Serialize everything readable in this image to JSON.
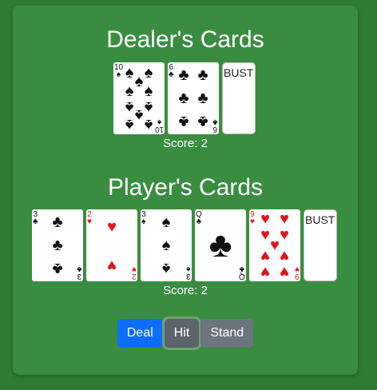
{
  "dealer": {
    "title": "Dealer's Cards",
    "score_text": "Score: 2",
    "bust_label": "BUST",
    "cards": [
      {
        "rank": "10",
        "suit": "♠",
        "color": "#111111"
      },
      {
        "rank": "6",
        "suit": "♣",
        "color": "#111111"
      }
    ]
  },
  "player": {
    "title": "Player's Cards",
    "score_text": "Score: 2",
    "bust_label": "BUST",
    "cards": [
      {
        "rank": "3",
        "suit": "♣",
        "color": "#111111"
      },
      {
        "rank": "2",
        "suit": "♥",
        "color": "#e0141e"
      },
      {
        "rank": "3",
        "suit": "♠",
        "color": "#111111"
      },
      {
        "rank": "Q",
        "suit": "♣",
        "color": "#111111"
      },
      {
        "rank": "9",
        "suit": "♥",
        "color": "#e0141e"
      }
    ]
  },
  "controls": {
    "deal_label": "Deal",
    "hit_label": "Hit",
    "stand_label": "Stand"
  },
  "colors": {
    "table": "#3a8d40",
    "background": "#2f7d32",
    "deal_button": "#0d6efd",
    "hit_button": "#5c636a",
    "stand_button": "#6c757d"
  }
}
